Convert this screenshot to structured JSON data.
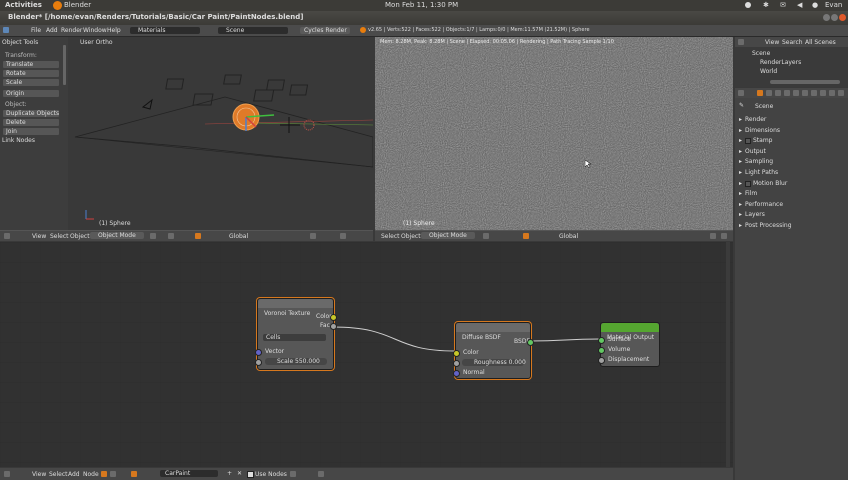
{
  "system_bar": {
    "activities": "Activities",
    "app": "Blender",
    "clock": "Mon Feb 11,  1:30 PM",
    "user": "Evan"
  },
  "window": {
    "title": "Blender* [/home/evan/Renders/Tutorials/Basic/Car Paint/PaintNodes.blend]"
  },
  "info_header": {
    "menus": [
      "File",
      "Add",
      "Render",
      "Window",
      "Help"
    ],
    "screen": "Materials",
    "scene": "Scene",
    "engine": "Cycles Render",
    "stats": "v2.65 | Verts:522 | Faces:522 | Objects:1/7 | Lamps:0/0 | Mem:11.57M (21.52M) | Sphere"
  },
  "viewport": {
    "label": "User Ortho",
    "object_label": "(1) Sphere"
  },
  "tool_shelf": {
    "title": "Object Tools",
    "transform_heading": "Transform:",
    "transform": [
      "Translate",
      "Rotate",
      "Scale"
    ],
    "origin": "Origin",
    "object_heading": "Object:",
    "object_tools": [
      "Duplicate Objects",
      "Delete",
      "Join"
    ],
    "link_nodes": "Link Nodes"
  },
  "render_view": {
    "status": "Mem: 8.28M, Peak: 8.28M | Scene | Elapsed: 00:05.06 | Rendering | Path Tracing Sample 1/10",
    "object_label": "(1) Sphere"
  },
  "view_header_left": {
    "menus": [
      "View",
      "Select",
      "Object"
    ],
    "mode": "Object Mode",
    "orientation": "Global"
  },
  "view_header_right": {
    "menus": [
      "Select",
      "Object"
    ],
    "mode": "Object Mode",
    "orientation": "Global"
  },
  "outliner": {
    "menus": [
      "View",
      "Search"
    ],
    "filter": "All Scenes",
    "items": [
      "Scene",
      "RenderLayers",
      "World"
    ]
  },
  "properties": {
    "scene": "Scene",
    "panels": [
      "Render",
      "Dimensions",
      "Stamp",
      "Output",
      "Sampling",
      "Light Paths",
      "Motion Blur",
      "Film",
      "Performance",
      "Layers",
      "Post Processing"
    ]
  },
  "nodes": {
    "voronoi": {
      "title": "Voronoi Texture",
      "out_color": "Color",
      "out_fac": "Fac",
      "coloring": "Cells",
      "in_vector": "Vector",
      "scale": "Scale 550.000"
    },
    "diffuse": {
      "title": "Diffuse BSDF",
      "out_bsdf": "BSDF",
      "in_color": "Color",
      "roughness": "Roughness 0.000",
      "in_normal": "Normal"
    },
    "output": {
      "title": "Material Output",
      "in_surface": "Surface",
      "in_volume": "Volume",
      "in_displacement": "Displacement"
    }
  },
  "node_header": {
    "menus": [
      "View",
      "Select",
      "Add",
      "Node"
    ],
    "material": "CarPaint",
    "use_nodes": "Use Nodes"
  },
  "colors": {
    "selected_outline": "#d6781e",
    "output_header": "#55a630",
    "socket_color": "#c7c729",
    "socket_shader": "#63c763",
    "socket_vector": "#6363c7",
    "socket_float": "#a1a1a1"
  }
}
